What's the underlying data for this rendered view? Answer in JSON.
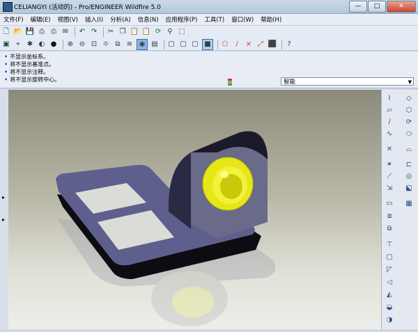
{
  "window": {
    "title": "CELIANGYI (活动的) - Pro/ENGINEER Wildfire 5.0",
    "min": "—",
    "max": "□",
    "close": "✕"
  },
  "menu": [
    "文件(F)",
    "编辑(E)",
    "视图(V)",
    "插入(I)",
    "分析(A)",
    "信息(N)",
    "应用程序(P)",
    "工具(T)",
    "窗口(W)",
    "帮助(H)"
  ],
  "messages": [
    "不显示坐标系。",
    "将不显示基准点。",
    "将不显示注释。",
    "将不显示旋转中心。"
  ],
  "filter": {
    "selected": "智能"
  },
  "colors": {
    "accent": "#1f4fd1",
    "model_body": "#5f5f8e",
    "model_yellow": "#e6e619",
    "panel": "#d9ddd6"
  },
  "icons": {
    "toolbar1": [
      "new-file-icon",
      "open-icon",
      "save-icon",
      "print-icon",
      "print-preview-icon",
      "email-icon",
      "cut-icon",
      "copy-icon",
      "paste-icon",
      "paste-special-icon",
      "regenerate-icon",
      "find-icon",
      "select-box-icon"
    ],
    "toolbar2": [
      "repaint-icon",
      "spin-center-icon",
      "orient-icon",
      "shading-icon",
      "appearance-icon",
      "zoom-in-icon",
      "zoom-out-icon",
      "refit-icon",
      "orient-mode-icon",
      "saved-views-icon",
      "layers-icon",
      "view-manager-icon",
      "wireframe-icon",
      "hidden-line-icon",
      "no-hidden-icon",
      "shaded-icon",
      "datum-planes-icon",
      "datum-axes-icon",
      "datum-points-icon",
      "coord-sys-icon",
      "help-icon"
    ],
    "rightbar": [
      "datum-plane-icon",
      "datum-axis-icon",
      "datum-curve-icon",
      "datum-point-icon",
      "coord-system-icon",
      "analysis-icon",
      "extrude-icon",
      "revolve-icon",
      "sweep-icon",
      "blend-icon",
      "hole-icon",
      "shell-icon",
      "rib-icon",
      "draft-icon",
      "round-icon",
      "chamfer-icon",
      "pattern-icon",
      "mirror-icon",
      "merge-icon",
      "trim-icon",
      "offset-icon",
      "thicken-icon",
      "solidify-icon"
    ]
  }
}
